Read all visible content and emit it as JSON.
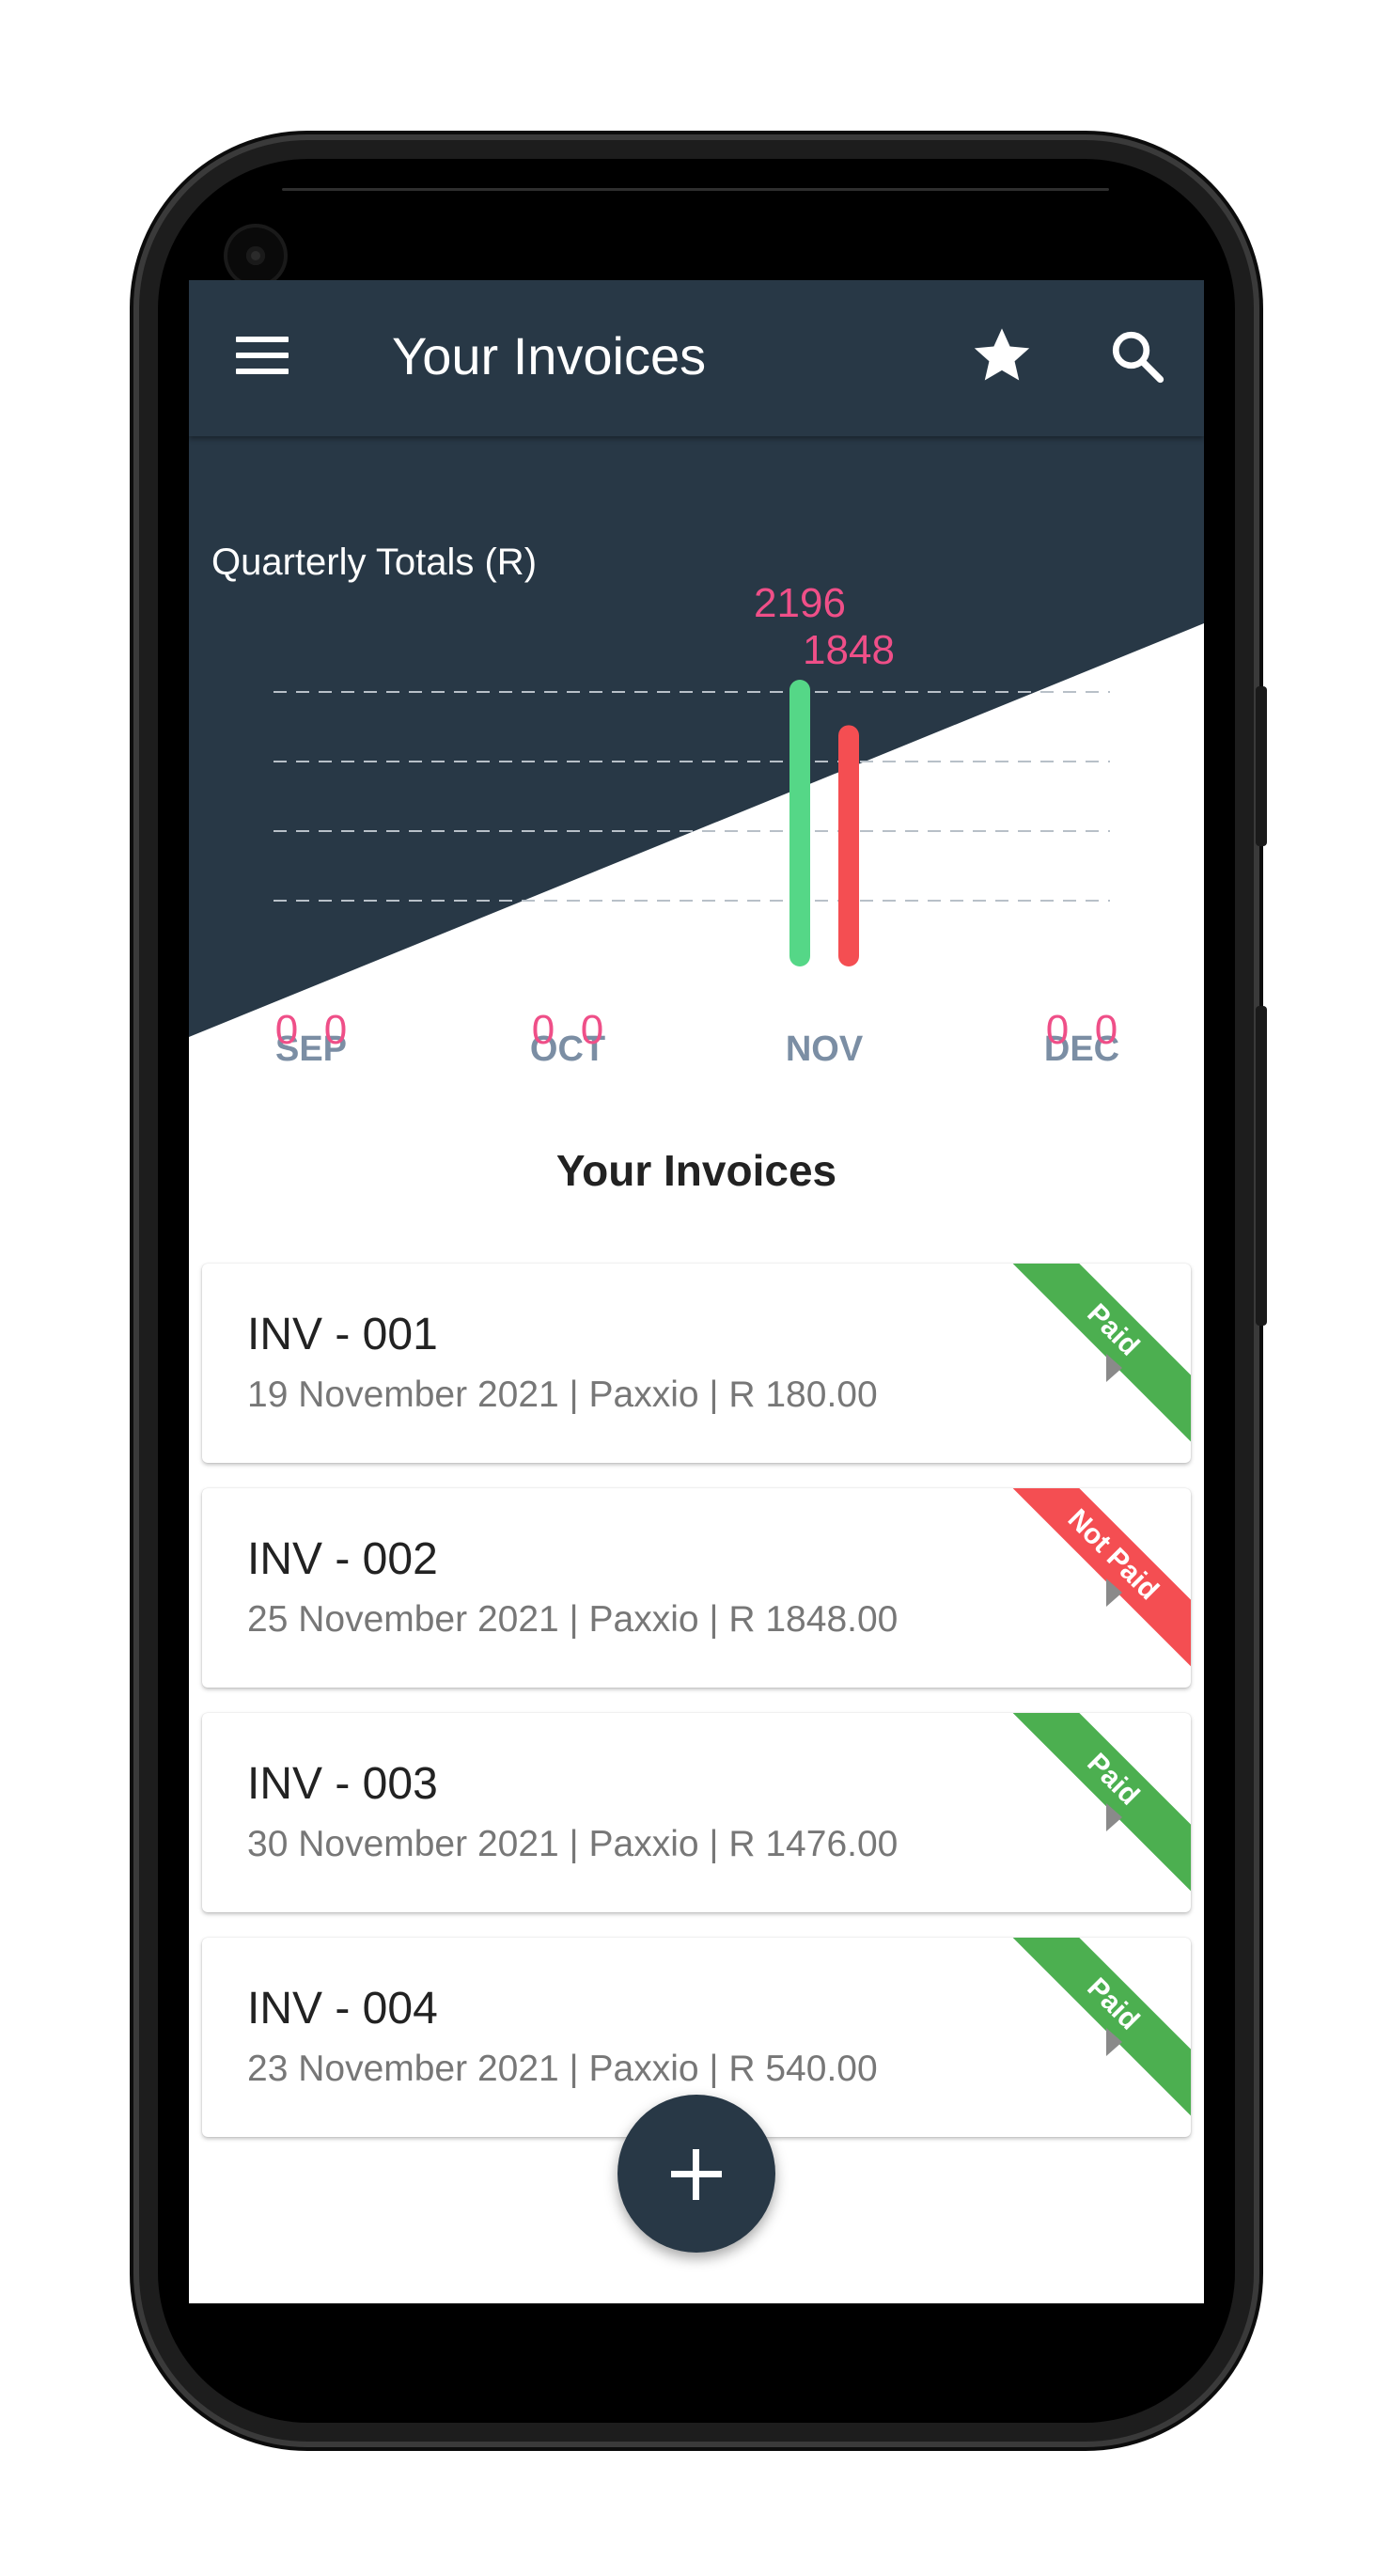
{
  "appbar": {
    "title": "Your Invoices"
  },
  "colors": {
    "primary": "#283846",
    "paid": "#4caf50",
    "not_paid": "#f44e52",
    "label_pink": "#ef4f88",
    "bar_green": "#55d787",
    "bar_red": "#f44e52"
  },
  "icons": {
    "menu": "menu-icon",
    "favorite": "star-icon",
    "search": "search-icon",
    "add": "plus-icon",
    "row_arrow": "play-arrow-icon"
  },
  "chart_data": {
    "type": "bar",
    "title": "Quarterly Totals (R)",
    "categories": [
      "SEP",
      "OCT",
      "NOV",
      "DEC"
    ],
    "series": [
      {
        "color": "#55d787",
        "values": [
          0,
          0,
          2196,
          0
        ]
      },
      {
        "color": "#f44e52",
        "values": [
          0,
          0,
          1848,
          0
        ]
      }
    ],
    "ylim": [
      0,
      2196
    ],
    "grid": true,
    "legend": "none"
  },
  "section": {
    "title": "Your Invoices"
  },
  "invoices": [
    {
      "title": "INV - 001",
      "subtitle": "19 November 2021 | Paxxio | R 180.00",
      "status": "Paid"
    },
    {
      "title": "INV - 002",
      "subtitle": "25 November 2021 | Paxxio | R 1848.00",
      "status": "Not Paid"
    },
    {
      "title": "INV - 003",
      "subtitle": "30 November 2021 | Paxxio | R 1476.00",
      "status": "Paid"
    },
    {
      "title": "INV - 004",
      "subtitle": "23 November 2021 | Paxxio | R 540.00",
      "status": "Paid"
    }
  ]
}
